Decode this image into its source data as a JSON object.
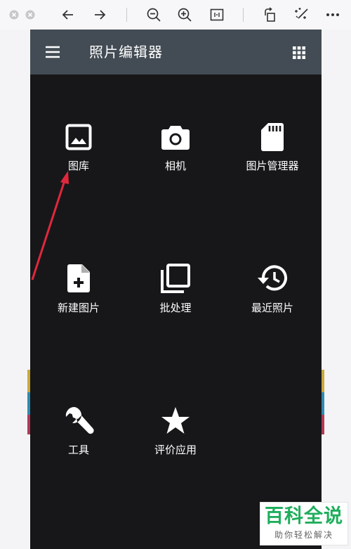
{
  "viewer": {
    "icons": [
      "close-dot-icon",
      "minimize-dot-icon",
      "back-arrow-icon",
      "forward-arrow-icon",
      "zoom-out-icon",
      "zoom-in-icon",
      "fit-actual-size-icon",
      "rotate-icon",
      "magic-wand-icon",
      "more-icon"
    ]
  },
  "app": {
    "title": "照片编辑器",
    "colors": {
      "appbar": "#434c54",
      "background": "#17171a",
      "annotation_arrow": "#e0283c"
    }
  },
  "tiles": [
    {
      "label": "图库",
      "icon": "image-icon"
    },
    {
      "label": "相机",
      "icon": "camera-icon"
    },
    {
      "label": "图片管理器",
      "icon": "sd-card-icon"
    },
    {
      "label": "新建图片",
      "icon": "new-file-icon"
    },
    {
      "label": "批处理",
      "icon": "batch-layers-icon"
    },
    {
      "label": "最近照片",
      "icon": "history-icon"
    },
    {
      "label": "工具",
      "icon": "wrench-icon"
    },
    {
      "label": "评价应用",
      "icon": "star-icon"
    }
  ],
  "watermark": {
    "title": "百科全说",
    "subtitle": "助你轻松解决"
  }
}
